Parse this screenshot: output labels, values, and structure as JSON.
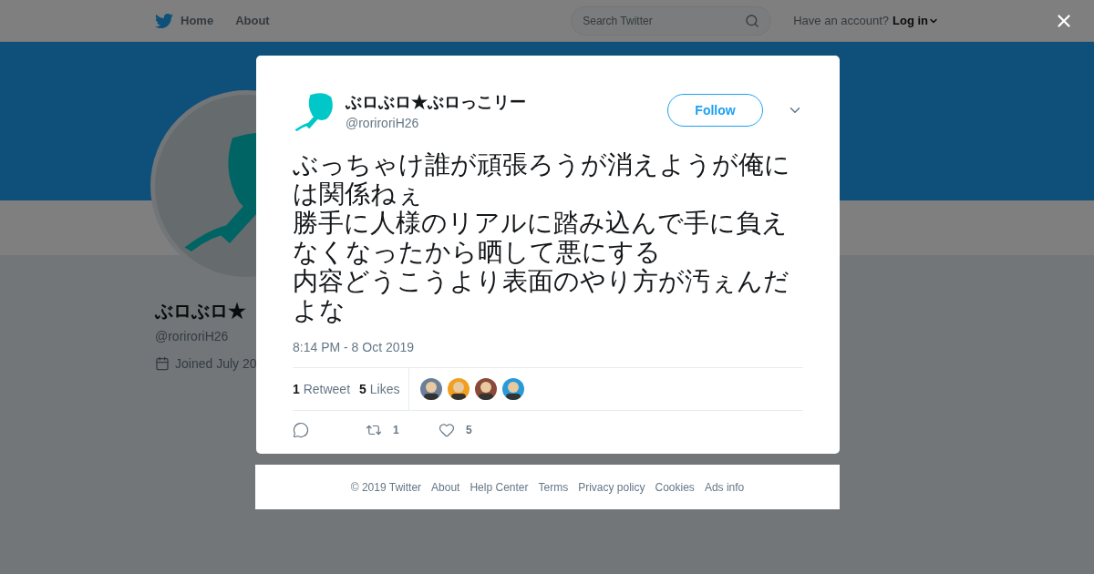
{
  "nav": {
    "items": [
      {
        "label": "Home"
      },
      {
        "label": "About"
      }
    ],
    "search": {
      "placeholder": "Search Twitter"
    },
    "account_prompt": "Have an account?",
    "login": "Log in"
  },
  "profile": {
    "name": "ぶロぶロ★",
    "handle": "@roriroriH26",
    "joined": "Joined July 20"
  },
  "tweet": {
    "name": "ぶロぶロ★ぶロっこリー",
    "handle": "@roriroriH26",
    "follow": "Follow",
    "paragraphs": [
      "ぶっちゃけ誰が頑張ろうが消えようが俺には関係ねぇ",
      "勝手に人様のリアルに踏み込んで手に負えなくなったから晒して悪にする",
      "内容どうこうより表面のやり方が汚ぇんだよな"
    ],
    "time": "8:14 PM - 8 Oct 2019",
    "stats": [
      {
        "count": "1",
        "label": "Retweet"
      },
      {
        "count": "5",
        "label": "Likes"
      }
    ],
    "likers": [
      {
        "kind": "picture"
      },
      {
        "kind": "picture"
      },
      {
        "kind": "picture"
      },
      {
        "kind": "picture"
      }
    ],
    "actions": [
      {
        "kind": "reply"
      },
      {
        "kind": "retweet",
        "count": "1"
      },
      {
        "kind": "like",
        "count": "5"
      }
    ]
  },
  "footer": [
    "© 2019 Twitter",
    "About",
    "Help Center",
    "Terms",
    "Privacy policy",
    "Cookies",
    "Ads info"
  ]
}
